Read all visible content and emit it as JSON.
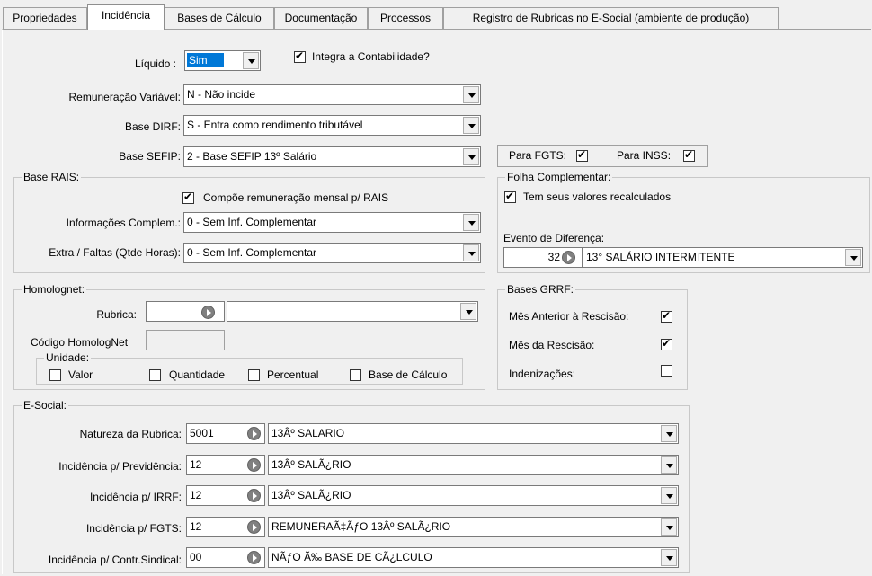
{
  "tabs": [
    "Propriedades",
    "Incidência",
    "Bases de Cálculo",
    "Documentação",
    "Processos",
    "Registro de Rubricas no E-Social (ambiente de produção)"
  ],
  "liquido": {
    "label": "Líquido :",
    "value": "Sim"
  },
  "integra_contabilidade": {
    "label": "Integra a Contabilidade?",
    "checked": true
  },
  "remuneracao_variavel": {
    "label": "Remuneração Variável:",
    "value": "N - Não incide"
  },
  "base_dirf": {
    "label": "Base DIRF:",
    "value": "S - Entra como rendimento tributável"
  },
  "base_sefip": {
    "label": "Base SEFIP:",
    "value": "2 - Base SEFIP 13º Salário"
  },
  "para_fgts": {
    "label": "Para FGTS:",
    "checked": true
  },
  "para_inss": {
    "label": "Para INSS:",
    "checked": true
  },
  "base_rais": {
    "title": "Base RAIS:",
    "compoe": {
      "label": "Compõe remuneração mensal p/ RAIS",
      "checked": true
    },
    "informacoes": {
      "label": "Informações Complem.:",
      "value": "0 - Sem Inf. Complementar"
    },
    "extra_faltas": {
      "label": "Extra / Faltas (Qtde Horas):",
      "value": "0 - Sem Inf. Complementar"
    }
  },
  "folha_complementar": {
    "title": "Folha Complementar:",
    "recalculados": {
      "label": "Tem seus valores recalculados",
      "checked": true
    },
    "evento_label": "Evento de Diferença:",
    "evento_code": "32",
    "evento_desc": "13° SALÁRIO INTERMITENTE"
  },
  "homolognet": {
    "title": "Homolognet:",
    "rubrica_label": "Rubrica:",
    "rubrica_code": "",
    "rubrica_desc": "",
    "codigo_label": "Código HomologNet",
    "codigo_value": "",
    "unidade": {
      "title": "Unidade:",
      "valor": "Valor",
      "quantidade": "Quantidade",
      "percentual": "Percentual",
      "base_calculo": "Base de Cálculo"
    }
  },
  "bases_grrf": {
    "title": "Bases GRRF:",
    "mes_anterior": {
      "label": "Mês Anterior à Rescisão:",
      "checked": true
    },
    "mes_rescisao": {
      "label": "Mês da Rescisão:",
      "checked": true
    },
    "indenizacoes": {
      "label": "Indenizações:",
      "checked": false
    }
  },
  "esocial": {
    "title": "E-Social:",
    "rows": [
      {
        "label": "Natureza da Rubrica:",
        "code": "5001",
        "desc": "13Âº SALARIO"
      },
      {
        "label": "Incidência p/ Previdência:",
        "code": "12",
        "desc": "13Âº SALÃ¿RIO"
      },
      {
        "label": "Incidência p/ IRRF:",
        "code": "12",
        "desc": "13Âº SALÃ¿RIO"
      },
      {
        "label": "Incidência p/ FGTS:",
        "code": "12",
        "desc": "REMUNERAÃ‡ÃƒO 13Âº SALÃ¿RIO"
      },
      {
        "label": "Incidência p/ Contr.Sindical:",
        "code": "00",
        "desc": "NÃƒO Ã‰ BASE DE CÃ¿LCULO"
      }
    ]
  }
}
